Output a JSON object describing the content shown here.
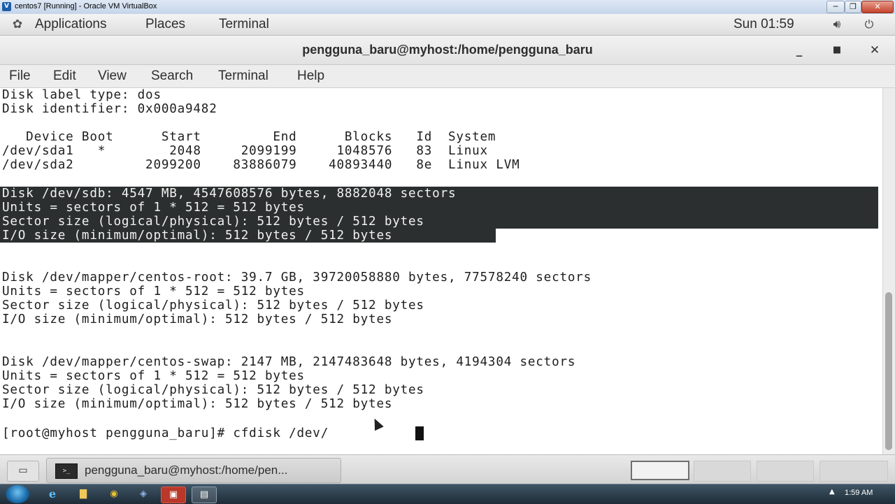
{
  "vbox": {
    "title": "centos7 [Running] - Oracle VM VirtualBox",
    "min_label": "─",
    "max_label": "❐",
    "close_label": "✕"
  },
  "gnome_panel": {
    "menus": [
      "Applications",
      "Places",
      "Terminal"
    ],
    "clock": "Sun 01:59",
    "icons": {
      "applications": "gnome-foot-icon",
      "volume": "volume-icon",
      "power": "power-icon"
    }
  },
  "terminal": {
    "title": "pengguna_baru@myhost:/home/pengguna_baru",
    "window_buttons": [
      "_",
      "■",
      "✕"
    ],
    "menu": [
      "File",
      "Edit",
      "View",
      "Search",
      "Terminal",
      "Help"
    ],
    "lines": [
      "Disk label type: dos",
      "Disk identifier: 0x000a9482",
      "",
      "   Device Boot      Start         End      Blocks   Id  System",
      "/dev/sda1   *        2048     2099199     1048576   83  Linux",
      "/dev/sda2         2099200    83886079    40893440   8e  Linux LVM",
      "",
      "Disk /dev/sdb: 4547 MB, 4547608576 bytes, 8882048 sectors",
      "Units = sectors of 1 * 512 = 512 bytes",
      "Sector size (logical/physical): 512 bytes / 512 bytes",
      "I/O size (minimum/optimal): 512 bytes / 512 bytes",
      "",
      "",
      "Disk /dev/mapper/centos-root: 39.7 GB, 39720058880 bytes, 77578240 sectors",
      "Units = sectors of 1 * 512 = 512 bytes",
      "Sector size (logical/physical): 512 bytes / 512 bytes",
      "I/O size (minimum/optimal): 512 bytes / 512 bytes",
      "",
      "",
      "Disk /dev/mapper/centos-swap: 2147 MB, 2147483648 bytes, 4194304 sectors",
      "Units = sectors of 1 * 512 = 512 bytes",
      "Sector size (logical/physical): 512 bytes / 512 bytes",
      "I/O size (minimum/optimal): 512 bytes / 512 bytes",
      "",
      "[root@myhost pengguna_baru]# cfdisk /dev/"
    ],
    "selection_line_indices": [
      7,
      8,
      9,
      10
    ]
  },
  "gnome_bottom": {
    "show_desktop_label": "▭",
    "task_label": "pengguna_baru@myhost:/home/pen...",
    "task_icon_label": ">_"
  },
  "win_taskbar": {
    "clock": "1:59 AM",
    "tray_arrow": "▲",
    "icons": [
      "ie-icon",
      "folder-icon",
      "chrome-icon",
      "virtualbox-icon",
      "app-icon",
      "vm-window-icon"
    ]
  }
}
